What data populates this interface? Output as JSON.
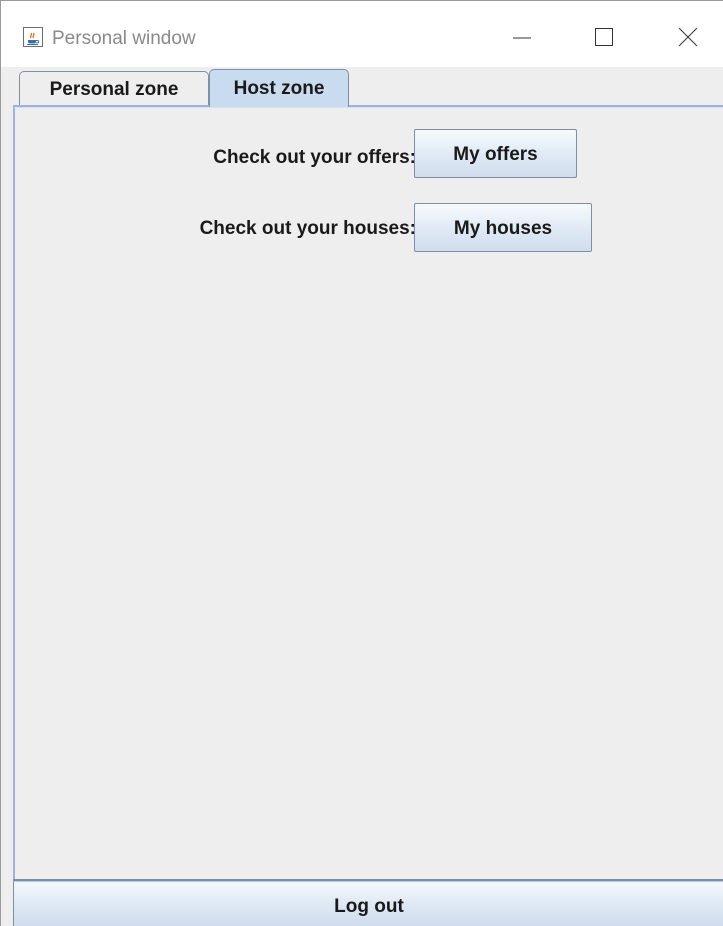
{
  "window": {
    "title": "Personal window"
  },
  "titlebar": {
    "app_icon": "java-cup-icon",
    "minimize_icon": "minimize-icon",
    "maximize_icon": "maximize-icon",
    "close_icon": "close-icon"
  },
  "tabs": [
    {
      "label": "Personal zone",
      "selected": false
    },
    {
      "label": "Host zone",
      "selected": true
    }
  ],
  "host_zone": {
    "offers_label": "Check out your offers:",
    "offers_button": "My offers",
    "houses_label": "Check out your houses:",
    "houses_button": "My houses"
  },
  "footer": {
    "logout_button": "Log out"
  },
  "colors": {
    "tab_selected": "#c9dbef",
    "panel_background": "#eeeeee",
    "border_accent": "#9db4d6"
  }
}
